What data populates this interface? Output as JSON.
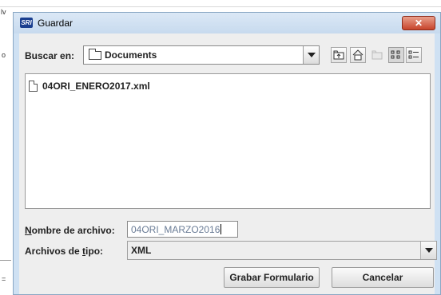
{
  "background": {
    "left_glyphs": [
      "lv",
      "o",
      "="
    ]
  },
  "window": {
    "title": "Guardar",
    "app_icon_text": "SRI",
    "close_glyph": "✕"
  },
  "look_in": {
    "label": "Buscar en:",
    "value": "Documents"
  },
  "toolbar": {
    "icons": [
      "up-one-level-icon",
      "home-icon",
      "new-folder-icon",
      "list-view-icon",
      "details-view-icon"
    ]
  },
  "files": [
    {
      "name": "04ORI_ENERO2017.xml"
    }
  ],
  "file_name": {
    "label_mnemonic": "N",
    "label_rest": "ombre de archivo:",
    "value": "04ORI_MARZO2016"
  },
  "file_type": {
    "label_before": "Archivos de ",
    "label_mnemonic": "t",
    "label_after": "ipo:",
    "value": "XML"
  },
  "buttons": {
    "save": "Grabar Formulario",
    "cancel": "Cancelar"
  }
}
